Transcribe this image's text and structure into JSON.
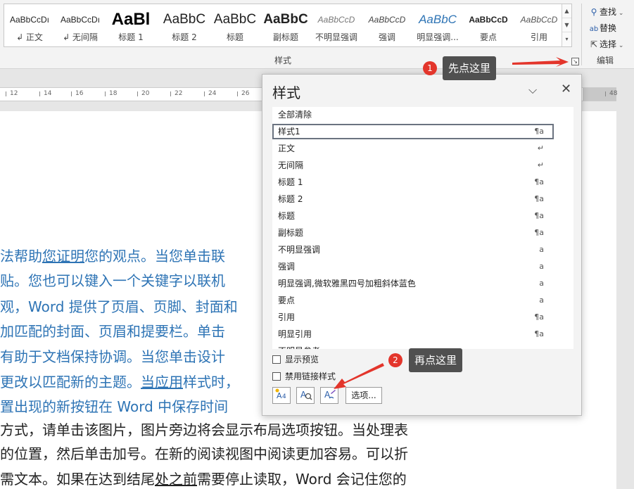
{
  "ribbon": {
    "styles_gallery": [
      {
        "preview": "AaBbCcDı",
        "name": "↲ 正文",
        "size": 12,
        "color": "#222222",
        "bold": false,
        "italic": false
      },
      {
        "preview": "AaBbCcDı",
        "name": "↲ 无间隔",
        "size": 12,
        "color": "#222222",
        "bold": false,
        "italic": false
      },
      {
        "preview": "AaBl",
        "name": "标题 1",
        "size": 24,
        "color": "#000000",
        "bold": true,
        "italic": false
      },
      {
        "preview": "AaBbC",
        "name": "标题 2",
        "size": 19,
        "color": "#222222",
        "bold": false,
        "italic": false
      },
      {
        "preview": "AaBbC",
        "name": "标题",
        "size": 19,
        "color": "#222222",
        "bold": false,
        "italic": false
      },
      {
        "preview": "AaBbC",
        "name": "副标题",
        "size": 19,
        "color": "#222222",
        "bold": true,
        "italic": false
      },
      {
        "preview": "AaBbCcD",
        "name": "不明显强调",
        "size": 12,
        "color": "#777777",
        "bold": false,
        "italic": true
      },
      {
        "preview": "AaBbCcD",
        "name": "强调",
        "size": 12,
        "color": "#444444",
        "bold": false,
        "italic": true
      },
      {
        "preview": "AaBbC",
        "name": "明显强调...",
        "size": 17,
        "color": "#2e74b5",
        "bold": false,
        "italic": true
      },
      {
        "preview": "AaBbCcD",
        "name": "要点",
        "size": 12,
        "color": "#222222",
        "bold": true,
        "italic": false
      },
      {
        "preview": "AaBbCcD",
        "name": "引用",
        "size": 12,
        "color": "#555555",
        "bold": false,
        "italic": true
      }
    ],
    "styles_group_label": "样式",
    "launcher_glyph": "↘",
    "editing": {
      "find": "查找",
      "replace": "替换",
      "select": "选择",
      "group_label": "编辑",
      "find_icon": "search-icon",
      "replace_icon": "replace-icon",
      "select_icon": "cursor-icon"
    }
  },
  "ruler": {
    "ticks": [
      "12",
      "14",
      "16",
      "18",
      "20",
      "22",
      "24",
      "26",
      "48"
    ]
  },
  "document": {
    "lines": [
      {
        "segments": [
          {
            "text": "法帮助",
            "u": false
          },
          {
            "text": "您证明",
            "u": true
          },
          {
            "text": "您的观点。当您单击联",
            "u": false
          }
        ],
        "color": "blue"
      },
      {
        "segments": [
          {
            "text": "贴。您也可以键入一个关键字以联机",
            "u": false
          }
        ],
        "color": "blue"
      },
      {
        "segments": [
          {
            "text": "观，Word 提供了页眉、页脚、封面和",
            "u": false
          }
        ],
        "color": "blue"
      },
      {
        "segments": [
          {
            "text": "加匹配的封面、页眉和提要栏。单击",
            "u": false
          }
        ],
        "color": "blue"
      },
      {
        "segments": [
          {
            "text": "有助于文档保持协调。当您单击设计",
            "u": false
          }
        ],
        "color": "blue"
      },
      {
        "segments": [
          {
            "text": "更改以匹配新的主题。",
            "u": false
          },
          {
            "text": "当应用",
            "u": true
          },
          {
            "text": "样式时，",
            "u": false
          }
        ],
        "color": "blue"
      },
      {
        "segments": [
          {
            "text": "置出现的新按钮在 Word 中保存时间",
            "u": false
          }
        ],
        "color": "blue"
      },
      {
        "segments": [
          {
            "text": "方式，请单击该图片，图片旁边将会显示布局选项按钮。当处理表",
            "u": false
          }
        ],
        "color": "black"
      },
      {
        "segments": [
          {
            "text": "的位置，然后单击加号。在新的阅读视图中阅读更加容易。可以折",
            "u": false
          }
        ],
        "color": "black"
      },
      {
        "segments": [
          {
            "text": "需文本。如果在达到结尾",
            "u": false
          },
          {
            "text": "处之前",
            "u": true
          },
          {
            "text": "需要停止读取，Word 会记住您的",
            "u": false
          }
        ],
        "color": "black"
      }
    ]
  },
  "styles_pane": {
    "title": "样式",
    "min_glyph": "⌵",
    "close_glyph": "✕",
    "items": [
      {
        "label": "全部清除",
        "mark": ""
      },
      {
        "label": "样式1",
        "mark": "¶a",
        "selected": true
      },
      {
        "label": "正文",
        "mark": "↵"
      },
      {
        "label": "无间隔",
        "mark": "↵"
      },
      {
        "label": "标题 1",
        "mark": "¶a"
      },
      {
        "label": "标题 2",
        "mark": "¶a"
      },
      {
        "label": "标题",
        "mark": "¶a"
      },
      {
        "label": "副标题",
        "mark": "¶a"
      },
      {
        "label": "不明显强调",
        "mark": "a"
      },
      {
        "label": "强调",
        "mark": "a"
      },
      {
        "label": "明显强调,微软雅黑四号加粗斜体蓝色",
        "mark": "a"
      },
      {
        "label": "要点",
        "mark": "a"
      },
      {
        "label": "引用",
        "mark": "¶a"
      },
      {
        "label": "明显引用",
        "mark": "¶a"
      },
      {
        "label": "不明显参考",
        "mark": "a"
      }
    ],
    "show_preview": "显示预览",
    "disable_linked": "禁用链接样式",
    "new_style_icon": "new-style-icon",
    "inspector_icon": "style-inspector-icon",
    "manage_icon": "manage-styles-icon",
    "options": "选项..."
  },
  "annotations": {
    "step1_num": "1",
    "step1_text": "先点这里",
    "step2_num": "2",
    "step2_text": "再点这里",
    "arrow_color": "#e3352b"
  }
}
